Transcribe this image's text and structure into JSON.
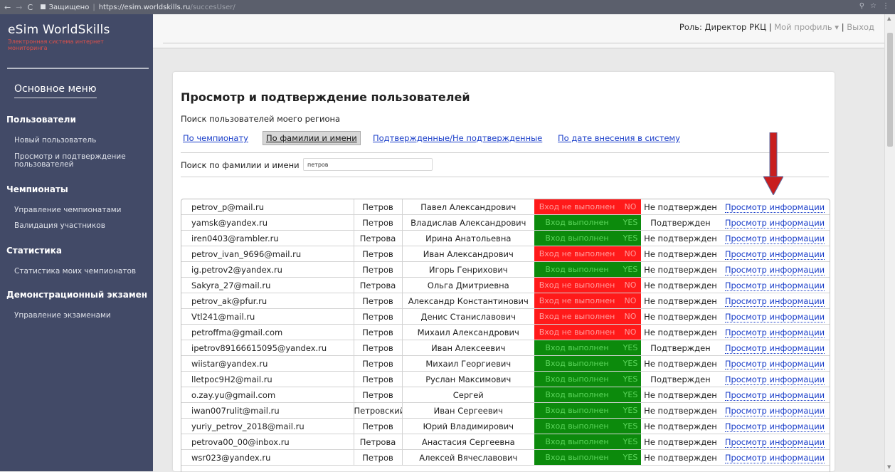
{
  "browser": {
    "secure_label": "Защищено",
    "url_host": "https://esim.worldskills.ru",
    "url_path": "/succesUser/"
  },
  "sidebar": {
    "brand": "eSim WorldSkills",
    "brand_sub": "Электронная система интернет мониторинга",
    "menu_title": "Основное меню",
    "sections": [
      {
        "title": "Пользователи",
        "items": [
          "Новый пользователь",
          "Просмотр и подтверждение пользователей"
        ]
      },
      {
        "title": "Чемпионаты",
        "items": [
          "Управление чемпионатами",
          "Валидация участников"
        ]
      },
      {
        "title": "Статистика",
        "items": [
          "Статистика моих чемпионатов"
        ]
      },
      {
        "title": "Демонстрационный экзамен",
        "items": [
          "Управление экзаменами"
        ]
      }
    ]
  },
  "topbar": {
    "role": "Роль: Директор РКЦ",
    "divider": "|",
    "profile": "Мой профиль",
    "profile_caret": "▾",
    "logout": "Выход"
  },
  "panel": {
    "title": "Просмотр и подтверждение пользователей",
    "note": "Поиск пользователей моего региона",
    "tabs": [
      "По чемпионату",
      "По фамилии и имени",
      "Подтвержденные/Не подтвержденные",
      "По дате внесения в систему"
    ],
    "active_tab": 1,
    "search_label": "Поиск по фамилии и имени",
    "search_value": "петров"
  },
  "table": {
    "login_ok": "Вход выполнен",
    "login_fail": "Вход не выполнен",
    "flag_ok": "YES",
    "flag_fail": "NO",
    "link_text": "Просмотр информации",
    "rows": [
      {
        "email": "petrov_p@mail.ru",
        "last": "Петров",
        "name": "Павел Александрович",
        "login": false,
        "status": "Не подтвержден"
      },
      {
        "email": "yamsk@yandex.ru",
        "last": "Петров",
        "name": "Владислав Александрович",
        "login": true,
        "status": "Подтвержден"
      },
      {
        "email": "iren0403@rambler.ru",
        "last": "Петрова",
        "name": "Ирина Анатольевна",
        "login": true,
        "status": "Не подтвержден"
      },
      {
        "email": "petrov_ivan_9696@mail.ru",
        "last": "Петров",
        "name": "Иван Александрович",
        "login": false,
        "status": "Не подтвержден"
      },
      {
        "email": "ig.petrov2@yandex.ru",
        "last": "Петров",
        "name": "Игорь Генрихович",
        "login": true,
        "status": "Не подтвержден"
      },
      {
        "email": "Sakyra_27@mail.ru",
        "last": "Петрова",
        "name": "Ольга Дмитриевна",
        "login": false,
        "status": "Не подтвержден"
      },
      {
        "email": "petrov_ak@pfur.ru",
        "last": "Петров",
        "name": "Александр Константинович",
        "login": false,
        "status": "Не подтвержден"
      },
      {
        "email": "Vtl241@mail.ru",
        "last": "Петров",
        "name": "Денис Станиславович",
        "login": false,
        "status": "Не подтвержден"
      },
      {
        "email": "petroffma@gmail.com",
        "last": "Петров",
        "name": "Михаил Александрович",
        "login": false,
        "status": "Не подтвержден"
      },
      {
        "email": "ipetrov89166615095@yandex.ru",
        "last": "Петров",
        "name": "Иван Алексеевич",
        "login": true,
        "status": "Подтвержден"
      },
      {
        "email": "wiistar@yandex.ru",
        "last": "Петров",
        "name": "Михаил Георгиевич",
        "login": true,
        "status": "Не подтвержден"
      },
      {
        "email": "lletpoc9H2@mail.ru",
        "last": "Петров",
        "name": "Руслан Максимович",
        "login": true,
        "status": "Подтвержден"
      },
      {
        "email": "o.zay.yu@gmail.com",
        "last": "Петров",
        "name": "Сергей",
        "login": true,
        "status": "Не подтвержден"
      },
      {
        "email": "iwan007rulit@mail.ru",
        "last": "Петровский",
        "name": "Иван Сергеевич",
        "login": true,
        "status": "Не подтвержден"
      },
      {
        "email": "yuriy_petrov_2018@mail.ru",
        "last": "Петров",
        "name": "Юрий Владимирович",
        "login": true,
        "status": "Не подтвержден"
      },
      {
        "email": "petrova00_00@inbox.ru",
        "last": "Петрова",
        "name": "Анастасия Сергеевна",
        "login": true,
        "status": "Не подтвержден"
      },
      {
        "email": "wsr023@yandex.ru",
        "last": "Петров",
        "name": "Алексей Вячеславович",
        "login": true,
        "status": "Не подтвержден"
      }
    ]
  },
  "colors": {
    "sidebar": "#424a67",
    "brand_accent": "#e0504a",
    "ok": "#0c8a0c",
    "fail": "#ff1a1a",
    "link": "#1a3ec9",
    "arrow": "#c81e1e"
  }
}
